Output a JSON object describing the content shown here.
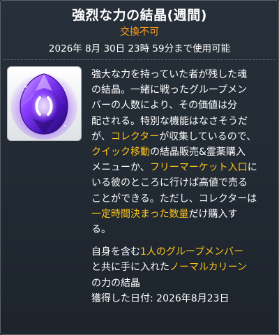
{
  "item": {
    "title": "強烈な力の結晶(週間)",
    "trade_status": "交換不可",
    "expiry": "2026年 8月 30日 23時 59分まで使用可能",
    "icon": "purple-crystal-icon"
  },
  "description": {
    "line1": "強大な力を持っていた者が残した魂",
    "line2": "の結晶。一緒に戦ったグループメン",
    "line3": "バーの人数により、その価値は分",
    "line4": "配される。特別な機能はなさそうだ",
    "line5_a": "が、",
    "line5_hl": "コレクター",
    "line5_b": "が収集しているので、",
    "line6_hl": "クイック移動",
    "line6_b": "の結晶販売&霊薬購入",
    "line7_a": "メニューか、",
    "line7_hl": "フリーマーケット入口",
    "line7_b": "に",
    "line8": "いる彼のところに行けば高値で売る",
    "line9": "ことができる。ただし、コレクターは",
    "line10_hl": "一定時間決まった数量",
    "line10_b": "だけ購入す",
    "line11": "る。"
  },
  "details": {
    "line1_a": "自身を含む",
    "line1_hl": "1人のグループメンバー",
    "line2_a": "と共に手に入れた",
    "line2_hl": "ノーマルカリーン",
    "line3": "の力の結晶",
    "acquired": "獲得した日付: 2026年8月23日"
  },
  "colors": {
    "highlight": "#ffc51a",
    "trade_status": "#ff9f1a",
    "background": "#1d242c"
  }
}
